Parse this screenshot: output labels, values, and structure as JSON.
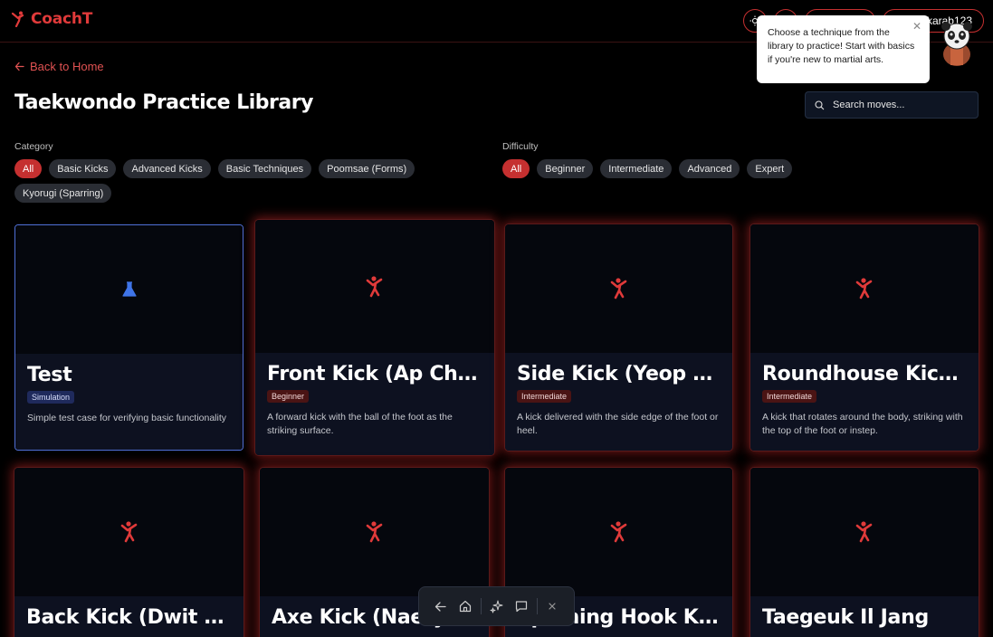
{
  "app": {
    "name": "CoachT"
  },
  "header": {
    "user_label": "skarab123",
    "colors": {
      "accent": "#e03a3a",
      "border": "#c53030"
    }
  },
  "tooltip": {
    "text": "Choose a technique from the library to practice! Start with basics if you're new to martial arts.",
    "close": "✕"
  },
  "nav": {
    "back_label": "Back to Home"
  },
  "page": {
    "title": "Taekwondo Practice Library"
  },
  "search": {
    "placeholder": "Search moves..."
  },
  "filters": {
    "category": {
      "label": "Category",
      "options": [
        "All",
        "Basic Kicks",
        "Advanced Kicks",
        "Basic Techniques",
        "Poomsae (Forms)",
        "Kyorugi (Sparring)"
      ],
      "selected": "All"
    },
    "difficulty": {
      "label": "Difficulty",
      "options": [
        "All",
        "Beginner",
        "Intermediate",
        "Advanced",
        "Expert"
      ],
      "selected": "All"
    }
  },
  "cards": [
    {
      "title": "Test",
      "badge": "Simulation",
      "badge_type": "sim",
      "description": "Simple test case for verifying basic functionality",
      "icon": "flask-icon"
    },
    {
      "title": "Front Kick (Ap Chagi)",
      "badge": "Beginner",
      "badge_type": "beg",
      "description": "A forward kick with the ball of the foot as the striking surface.",
      "icon": "kick-icon"
    },
    {
      "title": "Side Kick (Yeop Chagi)",
      "badge": "Intermediate",
      "badge_type": "int",
      "description": "A kick delivered with the side edge of the foot or heel.",
      "icon": "kick-icon"
    },
    {
      "title": "Roundhouse Kick (Dollyeo Chagi)",
      "badge": "Intermediate",
      "badge_type": "int",
      "description": "A kick that rotates around the body, striking with the top of the foot or instep.",
      "icon": "kick-icon"
    },
    {
      "title": "Back Kick (Dwit Chagi)",
      "badge": "",
      "badge_type": "",
      "description": "",
      "icon": "kick-icon"
    },
    {
      "title": "Axe Kick (Naeryeo Chagi)",
      "badge": "",
      "badge_type": "",
      "description": "",
      "icon": "kick-icon"
    },
    {
      "title": "Spinning Hook Kick",
      "badge": "",
      "badge_type": "",
      "description": "",
      "icon": "kick-icon"
    },
    {
      "title": "Taegeuk Il Jang",
      "badge": "",
      "badge_type": "",
      "description": "",
      "icon": "kick-icon"
    }
  ],
  "toolbar": {
    "items": [
      "back-icon",
      "home-icon",
      "sparkle-icon",
      "chat-icon",
      "close-icon"
    ]
  }
}
